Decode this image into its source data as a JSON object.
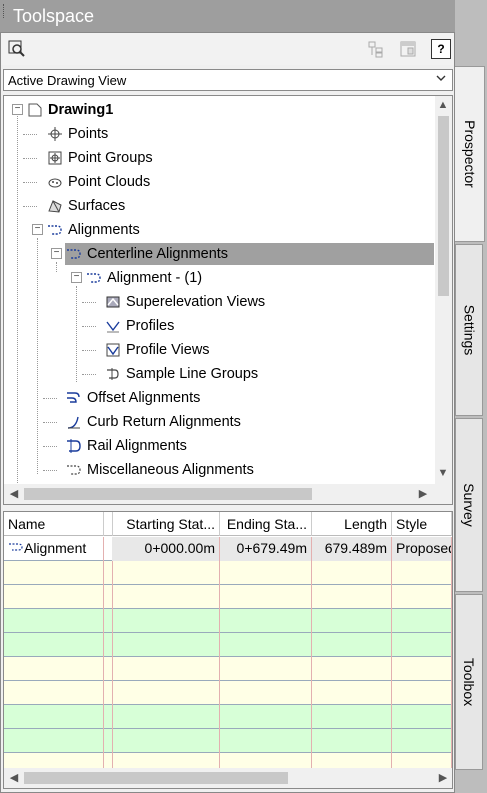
{
  "window": {
    "title": "Toolspace"
  },
  "toolbar": {
    "icons": [
      "search-icon",
      "item-view-icon",
      "panel-icon",
      "help-icon"
    ],
    "help_label": "?"
  },
  "view_select": {
    "value": "Active Drawing View"
  },
  "tree": {
    "root": "Drawing1",
    "items": {
      "points": "Points",
      "point_groups": "Point Groups",
      "point_clouds": "Point Clouds",
      "surfaces": "Surfaces",
      "alignments": "Alignments",
      "centerline": "Centerline Alignments",
      "alignment1": "Alignment - (1)",
      "superelevation": "Superelevation Views",
      "profiles": "Profiles",
      "profile_views": "Profile Views",
      "sample_lines": "Sample Line Groups",
      "offset": "Offset Alignments",
      "curb": "Curb Return Alignments",
      "rail": "Rail Alignments",
      "misc": "Miscellaneous Alignments"
    }
  },
  "grid": {
    "columns": [
      "Name",
      "Starting Stat...",
      "Ending Sta...",
      "Length",
      "Style"
    ],
    "rows": [
      [
        "Alignment",
        "0+000.00m",
        "0+679.49m",
        "679.489m",
        "Proposed"
      ]
    ]
  },
  "tabs": [
    "Prospector",
    "Settings",
    "Survey",
    "Toolbox"
  ],
  "colors": {
    "selected": "#a0a0a0",
    "row_yellow": "#ffffe6",
    "row_green": "#d7ffd7"
  }
}
